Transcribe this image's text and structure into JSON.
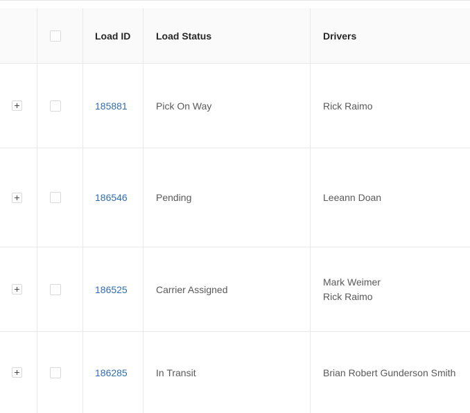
{
  "table": {
    "columns": {
      "expand": "",
      "select": "",
      "load_id": "Load ID",
      "load_status": "Load Status",
      "drivers": "Drivers"
    },
    "rows": [
      {
        "load_id": "185881",
        "load_status": "Pick On Way",
        "drivers": [
          "Rick Raimo"
        ]
      },
      {
        "load_id": "186546",
        "load_status": "Pending",
        "drivers": [
          "Leeann Doan"
        ]
      },
      {
        "load_id": "186525",
        "load_status": "Carrier Assigned",
        "drivers": [
          "Mark Weimer",
          "Rick Raimo"
        ]
      },
      {
        "load_id": "186285",
        "load_status": "In Transit",
        "drivers": [
          "Brian Robert Gunderson Smith"
        ]
      }
    ]
  },
  "icons": {
    "expand": "plus-icon",
    "select": "checkbox"
  },
  "colors": {
    "link": "#2f6db0",
    "header_bg": "#fafafa",
    "border": "#e8e8e8"
  }
}
